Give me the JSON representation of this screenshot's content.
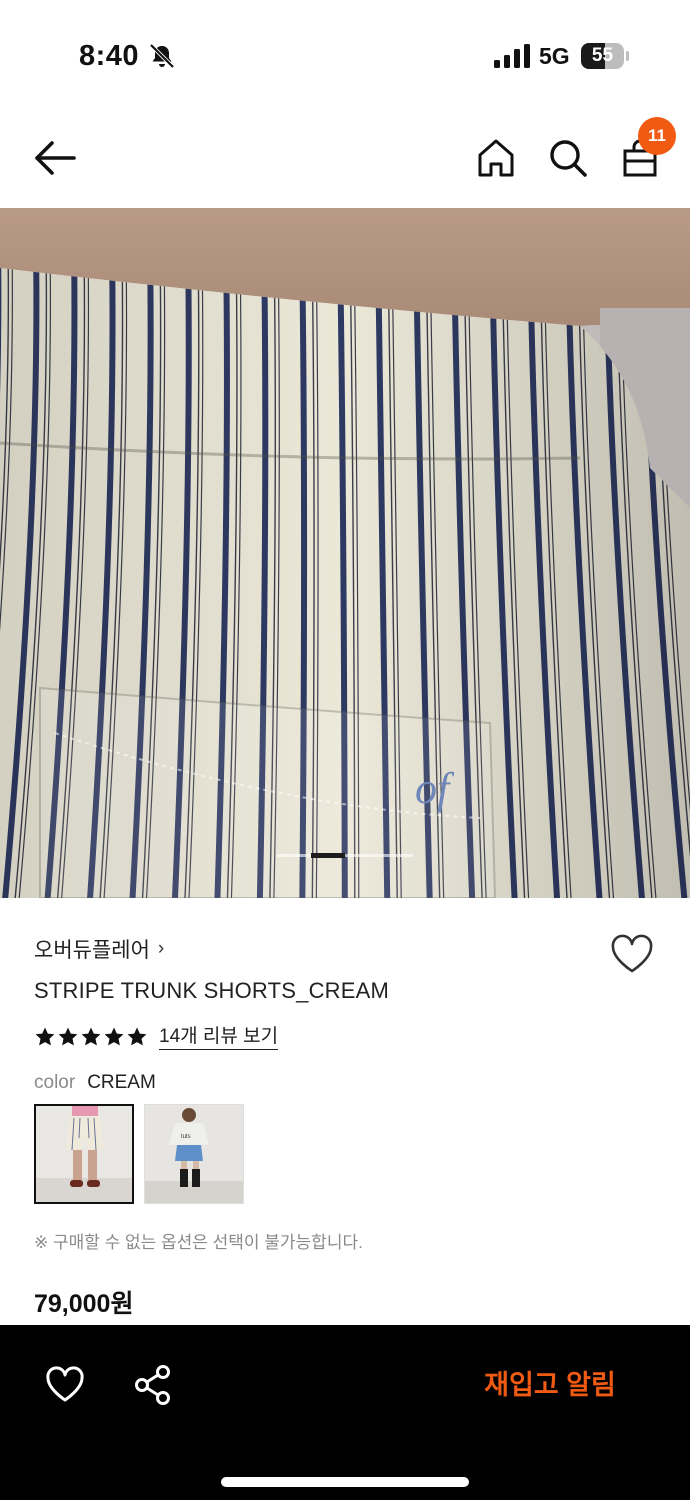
{
  "status_bar": {
    "time": "8:40",
    "network": "5G",
    "battery": "55",
    "battery_level": 0.55,
    "icons": [
      "bell-off-icon",
      "signal-icon",
      "battery-icon"
    ]
  },
  "header": {
    "icons": [
      "back-arrow-icon",
      "home-icon",
      "search-icon",
      "shopping-bag-icon"
    ],
    "cart_count": "11",
    "badge_color": "#f05a13"
  },
  "product": {
    "brand": "오버듀플레어",
    "brand_chevron": "›",
    "name": "STRIPE TRUNK SHORTS_CREAM",
    "rating_stars": 5,
    "review_link": "14개 리뷰 보기",
    "color_label": "color",
    "color_value": "CREAM",
    "option_note": "※ 구매할 수 없는 옵션은 선택이 불가능합니다.",
    "price": "79,000원",
    "photo_monogram": "of"
  },
  "carousel": {
    "active_index": 2,
    "total": 4
  },
  "bottom_bar": {
    "restock_label": "재입고 알림",
    "accent_color": "#f05a13",
    "icons": [
      "heart-icon",
      "share-icon"
    ]
  }
}
